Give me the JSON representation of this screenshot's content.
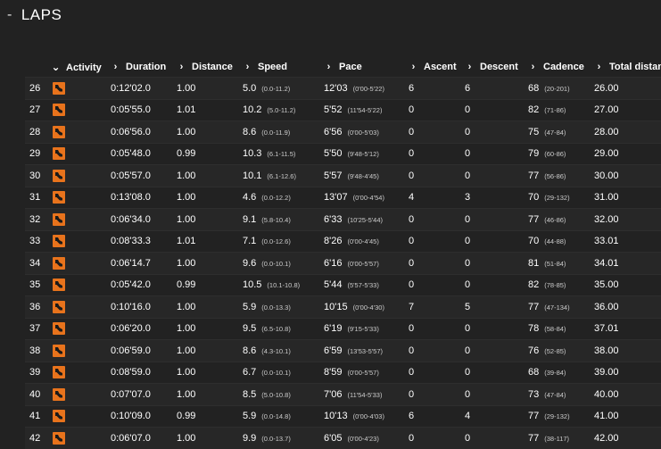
{
  "section": {
    "collapse_symbol": "-",
    "title": "LAPS"
  },
  "columns": [
    {
      "label": "Activity",
      "chevron": "down-chevron-icon"
    },
    {
      "label": "Duration",
      "chevron": "right-chevron-icon"
    },
    {
      "label": "Distance",
      "chevron": "right-chevron-icon"
    },
    {
      "label": "Speed",
      "chevron": "right-chevron-icon"
    },
    {
      "label": "Pace",
      "chevron": "right-chevron-icon"
    },
    {
      "label": "Ascent",
      "chevron": "right-chevron-icon"
    },
    {
      "label": "Descent",
      "chevron": "right-chevron-icon"
    },
    {
      "label": "Cadence",
      "chevron": "right-chevron-icon"
    },
    {
      "label": "Total distance",
      "chevron": "right-chevron-icon"
    }
  ],
  "activity_icon": "running-shoe-icon",
  "accent_color": "#e8731c",
  "laps": [
    {
      "lap": "26",
      "duration": "0:12'02.0",
      "distance": "1.00",
      "speed": "5.0",
      "speed_range": "(0.0-11.2)",
      "pace": "12'03",
      "pace_range": "(0'00-5'22)",
      "ascent": "6",
      "descent": "6",
      "cadence": "68",
      "cadence_range": "(20-201)",
      "total": "26.00"
    },
    {
      "lap": "27",
      "duration": "0:05'55.0",
      "distance": "1.01",
      "speed": "10.2",
      "speed_range": "(5.0-11.2)",
      "pace": "5'52",
      "pace_range": "(11'54-5'22)",
      "ascent": "0",
      "descent": "0",
      "cadence": "82",
      "cadence_range": "(71-86)",
      "total": "27.00"
    },
    {
      "lap": "28",
      "duration": "0:06'56.0",
      "distance": "1.00",
      "speed": "8.6",
      "speed_range": "(0.0-11.9)",
      "pace": "6'56",
      "pace_range": "(0'00-5'03)",
      "ascent": "0",
      "descent": "0",
      "cadence": "75",
      "cadence_range": "(47-84)",
      "total": "28.00"
    },
    {
      "lap": "29",
      "duration": "0:05'48.0",
      "distance": "0.99",
      "speed": "10.3",
      "speed_range": "(6.1-11.5)",
      "pace": "5'50",
      "pace_range": "(9'48-5'12)",
      "ascent": "0",
      "descent": "0",
      "cadence": "79",
      "cadence_range": "(60-86)",
      "total": "29.00"
    },
    {
      "lap": "30",
      "duration": "0:05'57.0",
      "distance": "1.00",
      "speed": "10.1",
      "speed_range": "(6.1-12.6)",
      "pace": "5'57",
      "pace_range": "(9'48-4'45)",
      "ascent": "0",
      "descent": "0",
      "cadence": "77",
      "cadence_range": "(56-86)",
      "total": "30.00"
    },
    {
      "lap": "31",
      "duration": "0:13'08.0",
      "distance": "1.00",
      "speed": "4.6",
      "speed_range": "(0.0-12.2)",
      "pace": "13'07",
      "pace_range": "(0'00-4'54)",
      "ascent": "4",
      "descent": "3",
      "cadence": "70",
      "cadence_range": "(29-132)",
      "total": "31.00"
    },
    {
      "lap": "32",
      "duration": "0:06'34.0",
      "distance": "1.00",
      "speed": "9.1",
      "speed_range": "(5.8-10.4)",
      "pace": "6'33",
      "pace_range": "(10'25-5'44)",
      "ascent": "0",
      "descent": "0",
      "cadence": "77",
      "cadence_range": "(46-86)",
      "total": "32.00"
    },
    {
      "lap": "33",
      "duration": "0:08'33.3",
      "distance": "1.01",
      "speed": "7.1",
      "speed_range": "(0.0-12.6)",
      "pace": "8'26",
      "pace_range": "(0'00-4'45)",
      "ascent": "0",
      "descent": "0",
      "cadence": "70",
      "cadence_range": "(44-88)",
      "total": "33.01"
    },
    {
      "lap": "34",
      "duration": "0:06'14.7",
      "distance": "1.00",
      "speed": "9.6",
      "speed_range": "(0.0-10.1)",
      "pace": "6'16",
      "pace_range": "(0'00-5'57)",
      "ascent": "0",
      "descent": "0",
      "cadence": "81",
      "cadence_range": "(51-84)",
      "total": "34.01"
    },
    {
      "lap": "35",
      "duration": "0:05'42.0",
      "distance": "0.99",
      "speed": "10.5",
      "speed_range": "(10.1-10.8)",
      "pace": "5'44",
      "pace_range": "(5'57-5'33)",
      "ascent": "0",
      "descent": "0",
      "cadence": "82",
      "cadence_range": "(78-85)",
      "total": "35.00"
    },
    {
      "lap": "36",
      "duration": "0:10'16.0",
      "distance": "1.00",
      "speed": "5.9",
      "speed_range": "(0.0-13.3)",
      "pace": "10'15",
      "pace_range": "(0'00-4'30)",
      "ascent": "7",
      "descent": "5",
      "cadence": "77",
      "cadence_range": "(47-134)",
      "total": "36.00"
    },
    {
      "lap": "37",
      "duration": "0:06'20.0",
      "distance": "1.00",
      "speed": "9.5",
      "speed_range": "(6.5-10.8)",
      "pace": "6'19",
      "pace_range": "(9'15-5'33)",
      "ascent": "0",
      "descent": "0",
      "cadence": "78",
      "cadence_range": "(58-84)",
      "total": "37.01"
    },
    {
      "lap": "38",
      "duration": "0:06'59.0",
      "distance": "1.00",
      "speed": "8.6",
      "speed_range": "(4.3-10.1)",
      "pace": "6'59",
      "pace_range": "(13'53-5'57)",
      "ascent": "0",
      "descent": "0",
      "cadence": "76",
      "cadence_range": "(52-85)",
      "total": "38.00"
    },
    {
      "lap": "39",
      "duration": "0:08'59.0",
      "distance": "1.00",
      "speed": "6.7",
      "speed_range": "(0.0-10.1)",
      "pace": "8'59",
      "pace_range": "(0'00-5'57)",
      "ascent": "0",
      "descent": "0",
      "cadence": "68",
      "cadence_range": "(39-84)",
      "total": "39.00"
    },
    {
      "lap": "40",
      "duration": "0:07'07.0",
      "distance": "1.00",
      "speed": "8.5",
      "speed_range": "(5.0-10.8)",
      "pace": "7'06",
      "pace_range": "(11'54-5'33)",
      "ascent": "0",
      "descent": "0",
      "cadence": "73",
      "cadence_range": "(47-84)",
      "total": "40.00"
    },
    {
      "lap": "41",
      "duration": "0:10'09.0",
      "distance": "0.99",
      "speed": "5.9",
      "speed_range": "(0.0-14.8)",
      "pace": "10'13",
      "pace_range": "(0'00-4'03)",
      "ascent": "6",
      "descent": "4",
      "cadence": "77",
      "cadence_range": "(29-132)",
      "total": "41.00"
    },
    {
      "lap": "42",
      "duration": "0:06'07.0",
      "distance": "1.00",
      "speed": "9.9",
      "speed_range": "(0.0-13.7)",
      "pace": "6'05",
      "pace_range": "(0'00-4'23)",
      "ascent": "0",
      "descent": "0",
      "cadence": "77",
      "cadence_range": "(38-117)",
      "total": "42.00"
    }
  ]
}
